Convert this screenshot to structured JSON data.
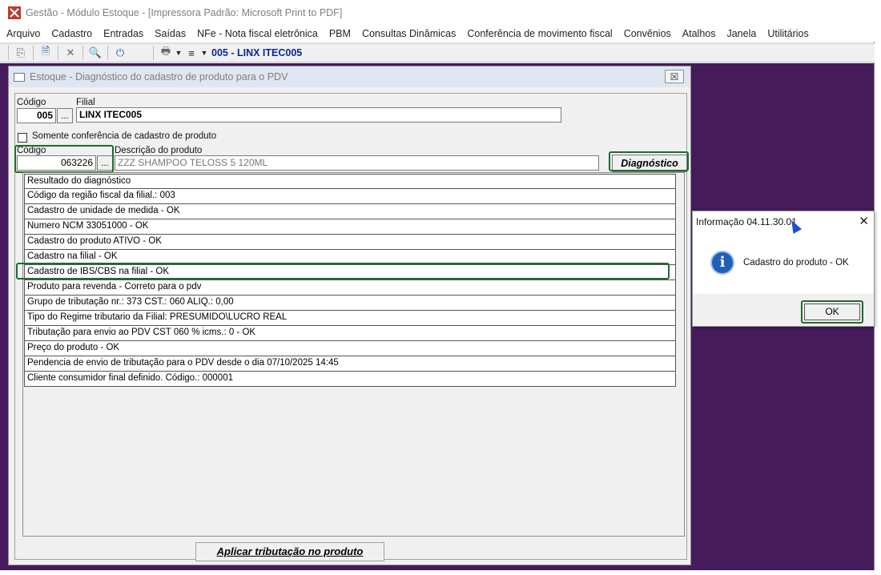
{
  "app": {
    "title": "Gestão  - Módulo Estoque - [Impressora Padrão: Microsoft Print to PDF]",
    "brand_color": "#c0392b",
    "workspace_color": "#451b5c"
  },
  "menu": [
    "Arquivo",
    "Cadastro",
    "Entradas",
    "Saídas",
    "NFe - Nota fiscal eletrônica",
    "PBM",
    "Consultas Dinâmicas",
    "Conferência de movimento fiscal",
    "Convênios",
    "Atalhos",
    "Janela",
    "Utilitários"
  ],
  "toolbar": {
    "store_label": "005 - LINX ITEC005"
  },
  "child_window": {
    "title": "Estoque - Diagnóstico do cadastro de produto para o PDV",
    "codigo_label": "Código",
    "codigo_value": "005",
    "filial_label": "Filial",
    "filial_value": "LINX ITEC005",
    "somente_label": "Somente conferência de cadastro de produto",
    "somente_checked": false,
    "produto_codigo_label": "Código",
    "produto_codigo_value": "063226",
    "descricao_label": "Descrição do produto",
    "descricao_value": "ZZZ SHAMPOO TELOSS 5 120ML",
    "diagnostico_button": "Diagnóstico",
    "dots": "...",
    "results_header": "Resultado do diagnóstico",
    "results": [
      "Código da região fiscal da filial.: 003",
      "Cadastro de unidade de medida - OK",
      "Numero NCM 33051000 - OK",
      "Cadastro do produto ATIVO - OK",
      "Cadastro na filial - OK",
      "Cadastro de IBS/CBS na filial - OK",
      "Produto para revenda - Correto para o pdv",
      "Grupo de tributação nr.: 373 CST.: 060 ALIQ.: 0,00",
      "Tipo do Regime tributario da Filial: PRESUMIDO\\LUCRO REAL",
      "Tributação para envio ao PDV CST 060 % icms.: 0 - OK",
      "Preço do produto - OK",
      "Pendencia de envio de tributação para o PDV desde o dia 07/10/2025 14:45",
      "Cliente consumidor final definido. Código.: 000001"
    ],
    "aplicar_button": "Aplicar tributação no produto"
  },
  "dialog": {
    "title": "Informação 04.11.30.01",
    "message": "Cadastro do produto - OK",
    "ok_label": "OK"
  }
}
